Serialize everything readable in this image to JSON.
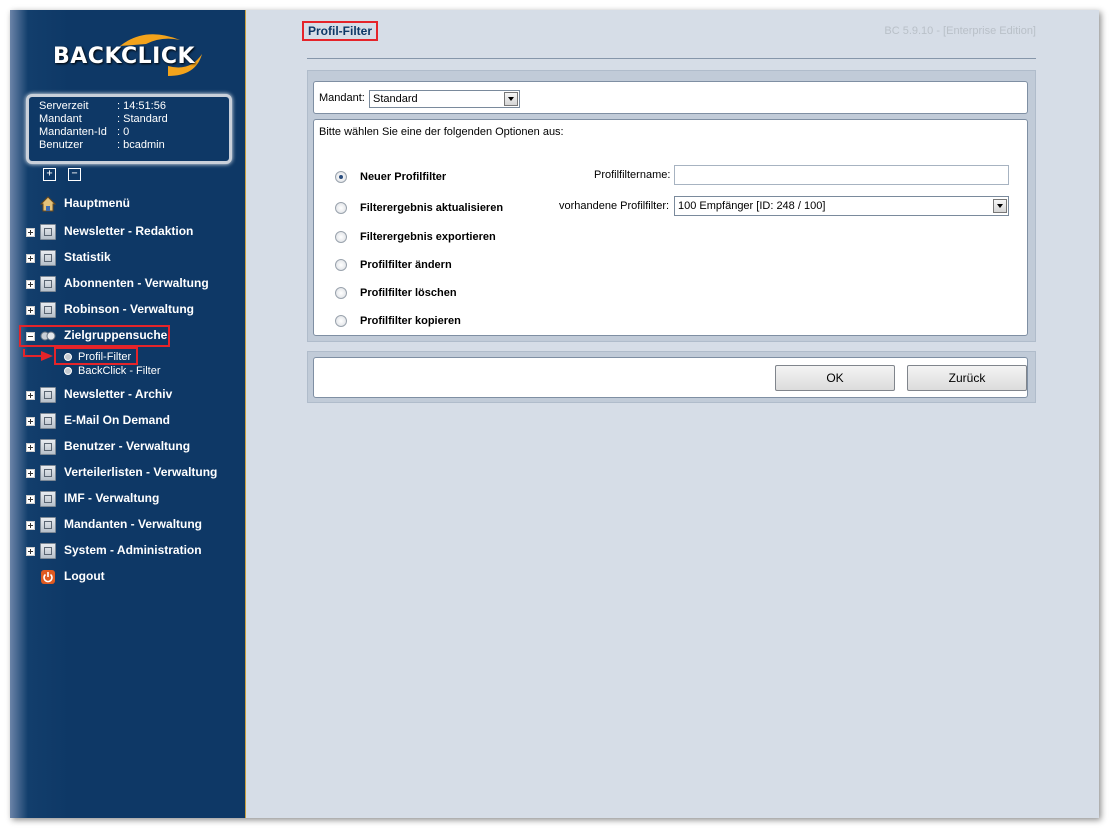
{
  "app": {
    "logo_text": "BACKCLICK",
    "version": "BC 5.9.10 - [Enterprise Edition]"
  },
  "info": [
    {
      "key": "Serverzeit",
      "value": ": 14:51:56"
    },
    {
      "key": "Mandant",
      "value": ": Standard"
    },
    {
      "key": "Mandanten-Id",
      "value": ": 0"
    },
    {
      "key": "Benutzer",
      "value": ": bcadmin"
    }
  ],
  "tree_controls": {
    "expand_all": "+",
    "collapse_all": "−"
  },
  "nav": {
    "hauptmenu": "Hauptmenü",
    "items": [
      {
        "label": "Newsletter - Redaktion"
      },
      {
        "label": "Statistik"
      },
      {
        "label": "Abonnenten - Verwaltung"
      },
      {
        "label": "Robinson - Verwaltung"
      },
      {
        "label": "Zielgruppensuche"
      },
      {
        "label": "Newsletter - Archiv"
      },
      {
        "label": "E-Mail On Demand"
      },
      {
        "label": "Benutzer - Verwaltung"
      },
      {
        "label": "Verteilerlisten - Verwaltung"
      },
      {
        "label": "IMF - Verwaltung"
      },
      {
        "label": "Mandanten - Verwaltung"
      },
      {
        "label": "System - Administration"
      }
    ],
    "sub_items": [
      {
        "label": "Profil-Filter"
      },
      {
        "label": "BackClick - Filter"
      }
    ],
    "logout": "Logout"
  },
  "page": {
    "title": "Profil-Filter",
    "mandant_label": "Mandant:",
    "mandant_value": "Standard",
    "instruction": "Bitte wählen Sie eine der folgenden Optionen aus:",
    "options": [
      {
        "label": "Neuer Profilfilter",
        "selected": true
      },
      {
        "label": "Filterergebnis aktualisieren",
        "selected": false
      },
      {
        "label": "Filterergebnis exportieren",
        "selected": false
      },
      {
        "label": "Profilfilter ändern",
        "selected": false
      },
      {
        "label": "Profilfilter löschen",
        "selected": false
      },
      {
        "label": "Profilfilter kopieren",
        "selected": false
      }
    ],
    "name_label": "Profilfiltername:",
    "name_value": "",
    "existing_label": "vorhandene Profilfilter:",
    "existing_value": "100 Empfänger [ID: 248 / 100]",
    "ok_label": "OK",
    "back_label": "Zurück"
  },
  "colors": {
    "sidebar": "#0e3866",
    "accent_red": "#e5242a",
    "content_bg": "#d6dde7"
  }
}
